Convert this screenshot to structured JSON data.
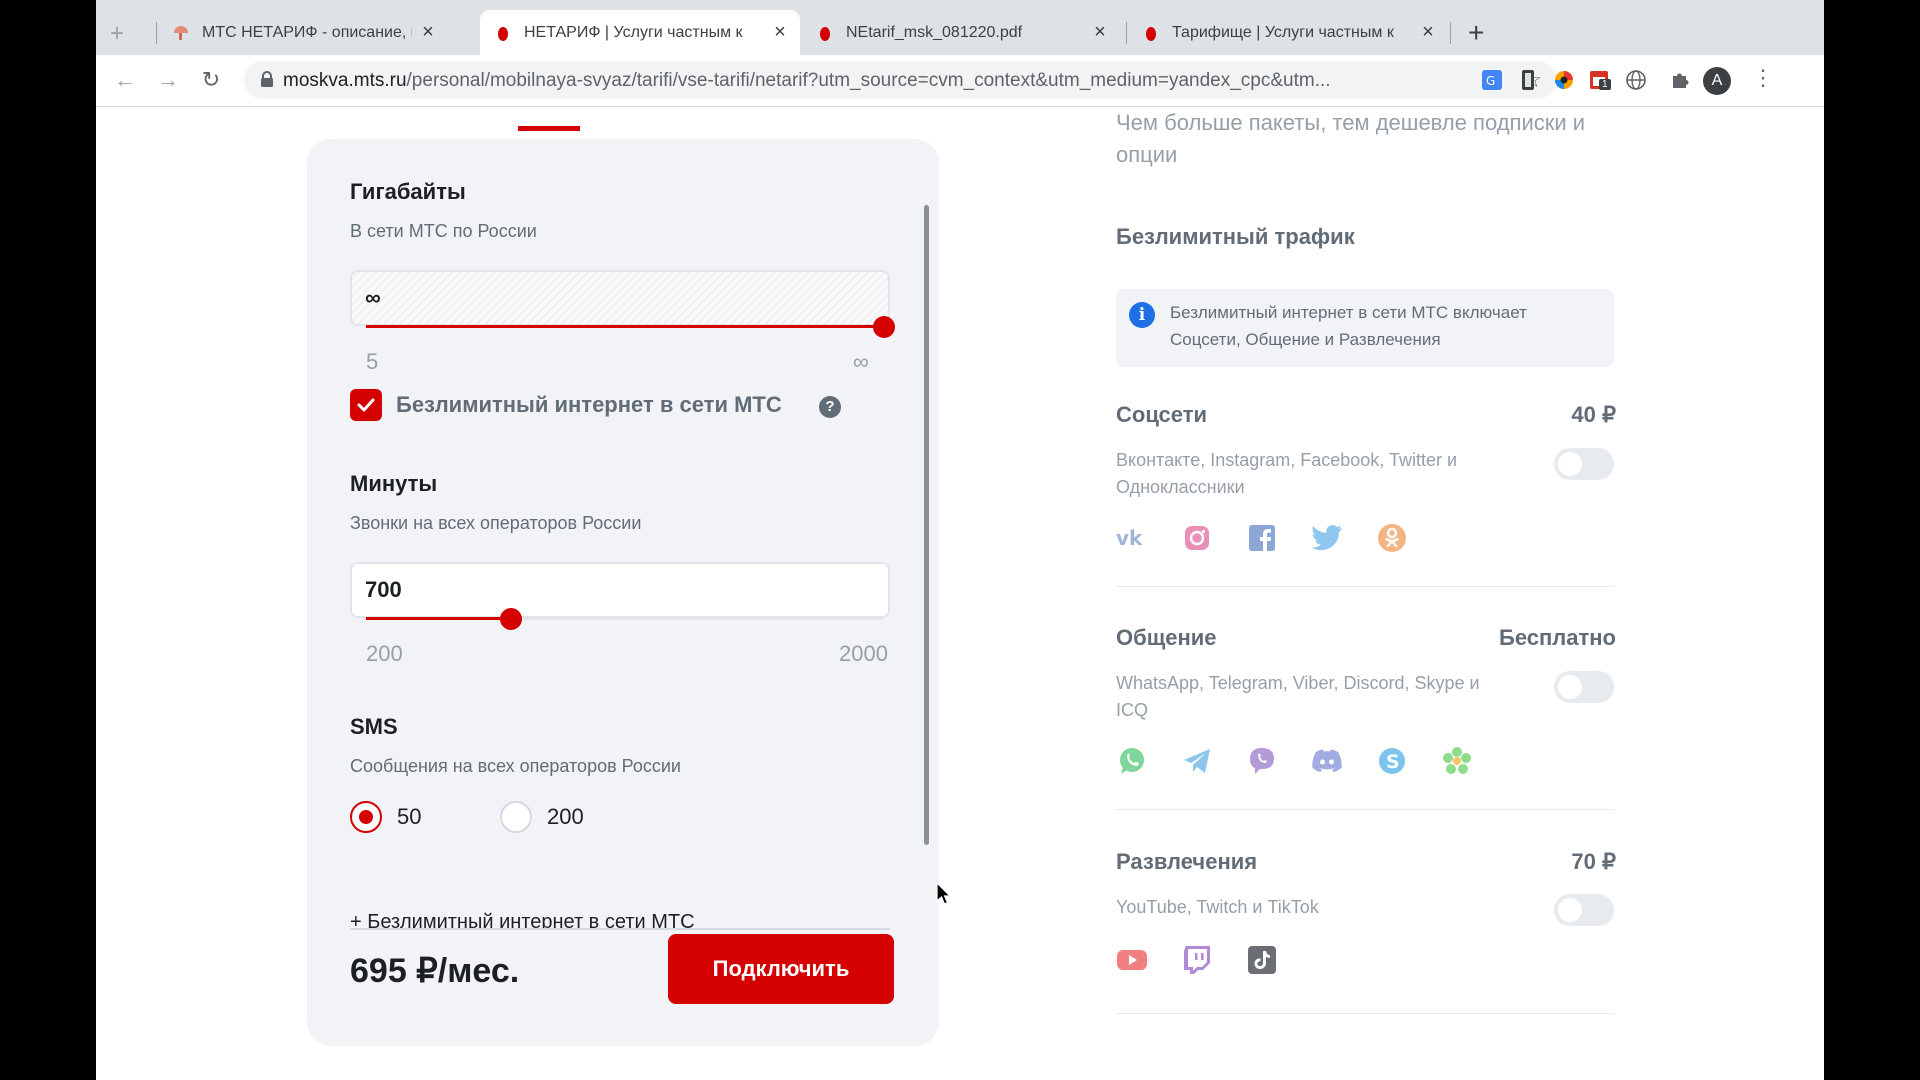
{
  "browser": {
    "tabs": [
      {
        "title": "МТС НЕТАРИФ - описание, ка",
        "active": false
      },
      {
        "title": "НЕТАРИФ | Услуги частным к",
        "active": true
      },
      {
        "title": "NEtarif_msk_081220.pdf",
        "active": false
      },
      {
        "title": "Тарифище | Услуги частным к",
        "active": false
      }
    ],
    "url_host": "moskva.mts.ru",
    "url_path": "/personal/mobilnaya-svyaz/tarifi/vse-tarifi/netarif?utm_source=cvm_context&utm_medium=yandex_cpc&utm...",
    "profile_initial": "A",
    "ext_badge": "1"
  },
  "constructor": {
    "gb": {
      "title_partial": "Гигабайты",
      "subtitle": "В сети МТС по России",
      "value": "∞",
      "min": "5",
      "max": "∞",
      "level_pct": 100
    },
    "unlimited_checkbox": {
      "label": "Безлимитный интернет в сети МТС",
      "checked": true
    },
    "minutes": {
      "title": "Минуты",
      "subtitle": "Звонки на всех операторов России",
      "value": "700",
      "min": "200",
      "max": "2000",
      "level_pct": 28
    },
    "sms": {
      "title": "SMS",
      "subtitle": "Сообщения на всех операторов России",
      "options": [
        {
          "label": "50",
          "selected": true
        },
        {
          "label": "200",
          "selected": false
        }
      ]
    },
    "summary_partial": "+ Безлимитный интернет в сети МТС",
    "price": "695 ₽/мес.",
    "connect_label": "Подключить"
  },
  "right": {
    "intro": "Чем больше пакеты, тем дешевле подписки и опции",
    "section_title": "Безлимитный трафик",
    "info": "Безлимитный интернет в сети МТС включает Соцсети, Общение и Развлечения",
    "options": [
      {
        "name": "Соцсети",
        "price": "40 ₽",
        "desc": "Вконтакте, Instagram, Facebook, Twitter и Одноклассники",
        "enabled": false,
        "icons": [
          "vk-icon",
          "instagram-icon",
          "facebook-icon",
          "twitter-icon",
          "odnoklassniki-icon"
        ]
      },
      {
        "name": "Общение",
        "price": "Бесплатно",
        "desc": "WhatsApp, Telegram, Viber, Discord, Skype и ICQ",
        "enabled": false,
        "icons": [
          "whatsapp-icon",
          "telegram-icon",
          "viber-icon",
          "discord-icon",
          "skype-icon",
          "icq-icon"
        ]
      },
      {
        "name": "Развлечения",
        "price": "70 ₽",
        "desc": "YouTube, Twitch и TikTok",
        "enabled": false,
        "icons": [
          "youtube-icon",
          "twitch-icon",
          "tiktok-icon"
        ]
      }
    ]
  },
  "colors": {
    "brand_red": "#d50000",
    "info_blue": "#1e6fe3"
  }
}
